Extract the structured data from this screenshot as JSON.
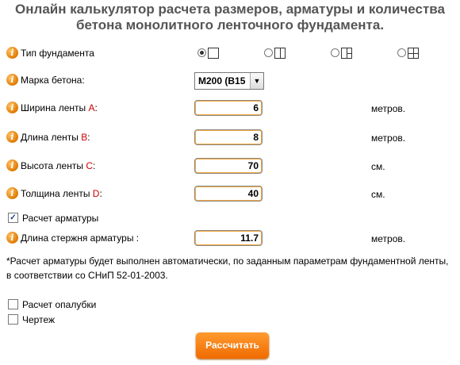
{
  "title_line1": "Онлайн калькулятор расчета размеров, арматуры и количества",
  "title_line2": "бетона монолитного ленточного фундамента.",
  "info_glyph": "i",
  "foundation": {
    "label": "Тип фундамента",
    "options": [
      "type-1",
      "type-2",
      "type-3",
      "type-4"
    ],
    "selected_index": 0
  },
  "concrete": {
    "label": "Марка бетона:",
    "value": "М200 (В15"
  },
  "fields": {
    "width": {
      "label": "Ширина ленты ",
      "letter": "A",
      "suffix": ":",
      "value": "6",
      "unit": "метров."
    },
    "length": {
      "label": "Длина ленты ",
      "letter": "B",
      "suffix": ":",
      "value": "8",
      "unit": "метров."
    },
    "height": {
      "label": "Высота ленты ",
      "letter": "C",
      "suffix": ":",
      "value": "70",
      "unit": "см."
    },
    "thick": {
      "label": "Толщина ленты ",
      "letter": "D",
      "suffix": ":",
      "value": "40",
      "unit": "см."
    }
  },
  "rebar_check": {
    "label": "Расчет арматуры",
    "checked": true,
    "mark": "✓"
  },
  "rebar_length": {
    "label": "Длина стержня арматуры :",
    "value": "11.7",
    "unit": "метров."
  },
  "note_line1": "*Расчет арматуры будет выполнен автоматически, по заданным параметрам фундаментной ленты,",
  "note_line2": "в соответствии со СНиП 52-01-2003.",
  "formwork_check": {
    "label": "Расчет опалубки",
    "checked": false
  },
  "drawing_check": {
    "label": "Чертеж",
    "checked": false
  },
  "calc_button": "Рассчитать",
  "colors": {
    "accent": "#f07a10",
    "label_red": "#cc0000",
    "title": "#555555"
  }
}
